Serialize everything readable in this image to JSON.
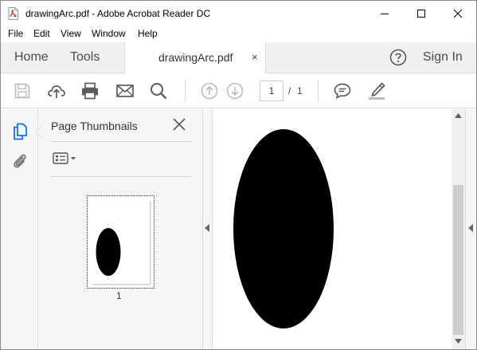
{
  "window": {
    "title": "drawingArc.pdf - Adobe Acrobat Reader DC",
    "controls": [
      "minimize",
      "maximize",
      "close"
    ]
  },
  "menu": {
    "items": [
      "File",
      "Edit",
      "View",
      "Window",
      "Help"
    ]
  },
  "tabs": {
    "home": "Home",
    "tools": "Tools",
    "document": "drawingArc.pdf",
    "close_glyph": "×",
    "sign_in": "Sign In"
  },
  "toolbar": {
    "icons": [
      "save-icon",
      "upload-cloud-icon",
      "print-icon",
      "email-icon",
      "search-icon",
      "page-up-icon",
      "page-down-icon",
      "comment-icon",
      "highlight-pen-icon"
    ],
    "page_current": "1",
    "page_separator": "/",
    "page_total": "1"
  },
  "sidebar": {
    "panel_title": "Page Thumbnails",
    "thumbnail_label": "1"
  },
  "colors": {
    "accent_blue": "#1473e6",
    "chrome_bg": "#f0f0f0",
    "panel_bg": "#f6f6f6",
    "icon_gray": "#6e6e6e",
    "shape_fill": "#000000"
  }
}
